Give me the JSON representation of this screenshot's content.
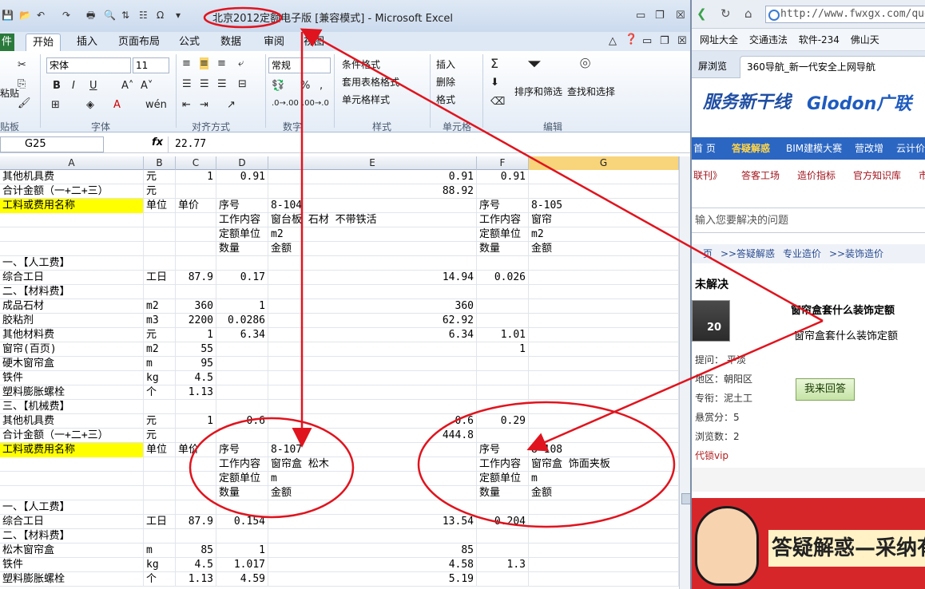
{
  "excel": {
    "title": "北京2012定额电子版  [兼容模式] - Microsoft Excel",
    "tabs": [
      "件",
      "开始",
      "插入",
      "页面布局",
      "公式",
      "数据",
      "审阅",
      "视图"
    ],
    "ribbon": {
      "font_name": "宋体",
      "font_size": "11",
      "number_format": "常规",
      "paste_label": "粘贴",
      "conditional_format": "条件格式",
      "table_format": "套用表格格式",
      "cell_styles": "单元格样式",
      "insert": "插入",
      "delete": "删除",
      "format": "格式",
      "sort_filter": "排序和筛选",
      "find_select": "查找和选择",
      "groups": [
        "贴板",
        "字体",
        "对齐方式",
        "数字",
        "样式",
        "单元格",
        "编辑"
      ]
    },
    "name_box": "G25",
    "formula_value": "22.77",
    "columns": [
      "A",
      "B",
      "C",
      "D",
      "E",
      "F",
      "G"
    ],
    "rows": [
      {
        "a": "其他机具费",
        "b": "元",
        "c": "1",
        "d": "0.91",
        "e": "0.91",
        "f": "0.91",
        "g": ""
      },
      {
        "a": "合计金额（一+二+三）",
        "b": "元",
        "c": "",
        "d": "",
        "e": "88.92",
        "f": "",
        "g": ""
      },
      {
        "a": "工料或费用名称",
        "b": "单位",
        "c": "单价",
        "d": "序号",
        "e": "8-104",
        "f": "序号",
        "g": "8-105",
        "hl": true
      },
      {
        "a": "",
        "b": "",
        "c": "",
        "d": "工作内容",
        "e": "窗台板 石材 不带铁活",
        "f": "工作内容",
        "g": "窗帘"
      },
      {
        "a": "",
        "b": "",
        "c": "",
        "d": "定额单位",
        "e": "m2",
        "f": "定额单位",
        "g": "m2"
      },
      {
        "a": "",
        "b": "",
        "c": "",
        "d": "数量",
        "e": "金额",
        "f": "数量",
        "g": "金额"
      },
      {
        "a": "一、【人工费】",
        "b": "",
        "c": "",
        "d": "",
        "e": "",
        "f": "",
        "g": ""
      },
      {
        "a": "综合工日",
        "b": "工日",
        "c": "87.9",
        "d": "0.17",
        "e": "14.94",
        "f": "0.026",
        "g": ""
      },
      {
        "a": "二、【材料费】",
        "b": "",
        "c": "",
        "d": "",
        "e": "",
        "f": "",
        "g": ""
      },
      {
        "a": "成品石材",
        "b": "m2",
        "c": "360",
        "d": "1",
        "e": "360",
        "f": "",
        "g": ""
      },
      {
        "a": "胶粘剂",
        "b": "m3",
        "c": "2200",
        "d": "0.0286",
        "e": "62.92",
        "f": "",
        "g": ""
      },
      {
        "a": "其他材料费",
        "b": "元",
        "c": "1",
        "d": "6.34",
        "e": "6.34",
        "f": "1.01",
        "g": ""
      },
      {
        "a": "窗帘(百页)",
        "b": "m2",
        "c": "55",
        "d": "",
        "e": "",
        "f": "1",
        "g": ""
      },
      {
        "a": "硬木窗帘盒",
        "b": "m",
        "c": "95",
        "d": "",
        "e": "",
        "f": "",
        "g": ""
      },
      {
        "a": "铁件",
        "b": "kg",
        "c": "4.5",
        "d": "",
        "e": "",
        "f": "",
        "g": ""
      },
      {
        "a": "塑料膨胀螺栓",
        "b": "个",
        "c": "1.13",
        "d": "",
        "e": "",
        "f": "",
        "g": ""
      },
      {
        "a": "三、【机械费】",
        "b": "",
        "c": "",
        "d": "",
        "e": "",
        "f": "",
        "g": ""
      },
      {
        "a": "其他机具费",
        "b": "元",
        "c": "1",
        "d": "0.6",
        "e": "0.6",
        "f": "0.29",
        "g": ""
      },
      {
        "a": "合计金额（一+二+三）",
        "b": "元",
        "c": "",
        "d": "",
        "e": "444.8",
        "f": "",
        "g": ""
      },
      {
        "a": "工料或费用名称",
        "b": "单位",
        "c": "单价",
        "d": "序号",
        "e": "8-107",
        "f": "序号",
        "g": "8-108",
        "hl": true
      },
      {
        "a": "",
        "b": "",
        "c": "",
        "d": "工作内容",
        "e": "窗帘盒 松木",
        "f": "工作内容",
        "g": "窗帘盒 饰面夹板"
      },
      {
        "a": "",
        "b": "",
        "c": "",
        "d": "定额单位",
        "e": "m",
        "f": "定额单位",
        "g": "m"
      },
      {
        "a": "",
        "b": "",
        "c": "",
        "d": "数量",
        "e": "金额",
        "f": "数量",
        "g": "金额"
      },
      {
        "a": "一、【人工费】",
        "b": "",
        "c": "",
        "d": "",
        "e": "",
        "f": "",
        "g": ""
      },
      {
        "a": "综合工日",
        "b": "工日",
        "c": "87.9",
        "d": "0.154",
        "e": "13.54",
        "f": "0.204",
        "g": ""
      },
      {
        "a": "二、【材料费】",
        "b": "",
        "c": "",
        "d": "",
        "e": "",
        "f": "",
        "g": ""
      },
      {
        "a": "松木窗帘盒",
        "b": "m",
        "c": "85",
        "d": "1",
        "e": "85",
        "f": "",
        "g": ""
      },
      {
        "a": "铁件",
        "b": "kg",
        "c": "4.5",
        "d": "1.017",
        "e": "4.58",
        "f": "1.3",
        "g": ""
      },
      {
        "a": "塑料膨胀螺栓",
        "b": "个",
        "c": "1.13",
        "d": "4.59",
        "e": "5.19",
        "f": "",
        "g": ""
      }
    ]
  },
  "browser": {
    "url": "http://www.fwxgx.com/que",
    "favorites": [
      "网址大全",
      "交通违法",
      "软件-234",
      "佛山天"
    ],
    "tab_left": "屏浏览",
    "tab_active": "360导航_新一代安全上网导航",
    "logo_left": "服务新干线",
    "logo_right": "Glodon广联",
    "nav": [
      "首 页",
      "答疑解惑",
      "BIM建模大赛",
      "营改增",
      "云计价"
    ],
    "subnav": [
      "联刊》",
      "答客工场",
      "造价指标",
      "官方知识库",
      "市"
    ],
    "search_placeholder": "输入您要解决的问题",
    "breadcrumb": [
      "页",
      ">>",
      "答疑解惑",
      "专业造价",
      ">>",
      "装饰造价"
    ],
    "status": "未解决",
    "question_title": "窗帘盒套什么装饰定额",
    "question_body": "窗帘盒套什么装饰定额",
    "info": [
      "提问： 平淡",
      "地区：朝阳区",
      "专衔：泥土工",
      "悬赏分：5",
      "浏览数：2"
    ],
    "answer_button": "我来回答",
    "vip": "代锁vip",
    "banner_text": "答疑解惑—采纳有"
  },
  "annotation_color": "#e0141e"
}
